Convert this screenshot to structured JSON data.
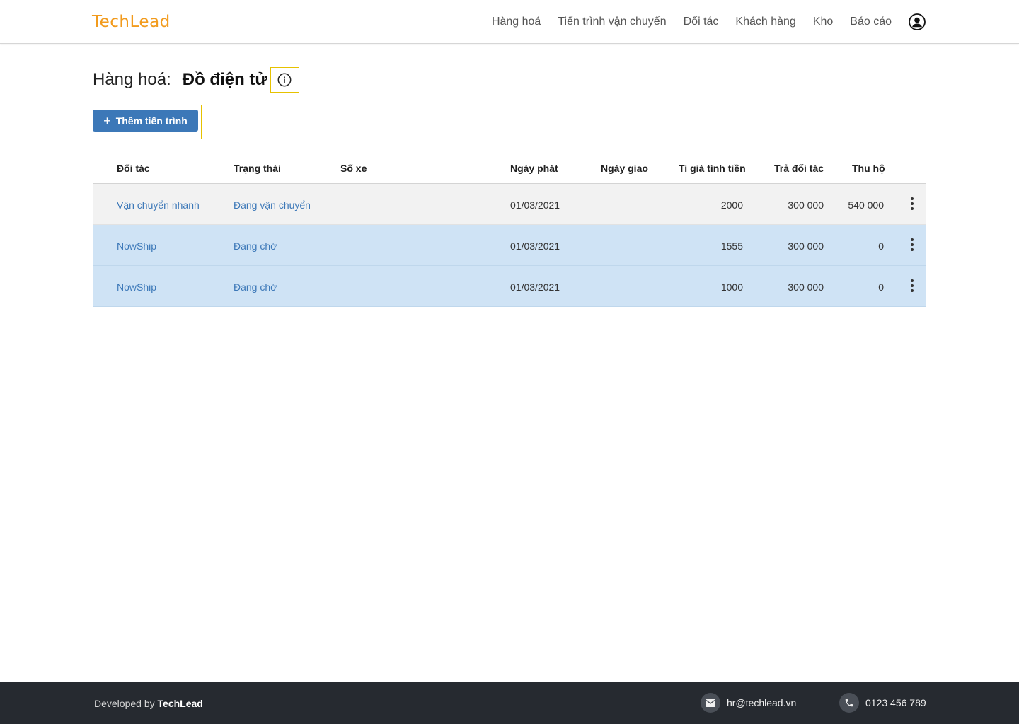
{
  "header": {
    "logo": "TechLead",
    "nav": [
      "Hàng hoá",
      "Tiến trình vận chuyển",
      "Đối tác",
      "Khách hàng",
      "Kho",
      "Báo cáo"
    ]
  },
  "page": {
    "title_label": "Hàng hoá:",
    "title_value": "Đồ điện tử",
    "add_button": "Thêm tiến trình"
  },
  "table": {
    "columns": {
      "partner": "Đối tác",
      "status": "Trạng thái",
      "plate": "Số xe",
      "ship_date": "Ngày phát",
      "delivery_date": "Ngày giao",
      "rate": "Ti giá tính tiền",
      "pay_partner": "Trả đối tác",
      "cod": "Thu hộ"
    },
    "rows": [
      {
        "partner": "Vận chuyển nhanh",
        "status": "Đang vận chuyển",
        "plate": "",
        "ship_date": "01/03/2021",
        "delivery_date": "",
        "rate": "2000",
        "pay_partner": "300 000",
        "cod": "540 000"
      },
      {
        "partner": "NowShip",
        "status": "Đang chờ",
        "plate": "",
        "ship_date": "01/03/2021",
        "delivery_date": "",
        "rate": "1555",
        "pay_partner": "300 000",
        "cod": "0"
      },
      {
        "partner": "NowShip",
        "status": "Đang chờ",
        "plate": "",
        "ship_date": "01/03/2021",
        "delivery_date": "",
        "rate": "1000",
        "pay_partner": "300 000",
        "cod": "0"
      }
    ]
  },
  "footer": {
    "developed_by": "Developed by",
    "brand": "TechLead",
    "email": "hr@techlead.vn",
    "phone": "0123 456 789"
  },
  "colors": {
    "brand_orange": "#f29b1d",
    "primary_blue": "#3c78b8",
    "row_selected": "#cfe3f5",
    "footer_bg": "#262a30",
    "highlight_border": "#e6c200"
  }
}
